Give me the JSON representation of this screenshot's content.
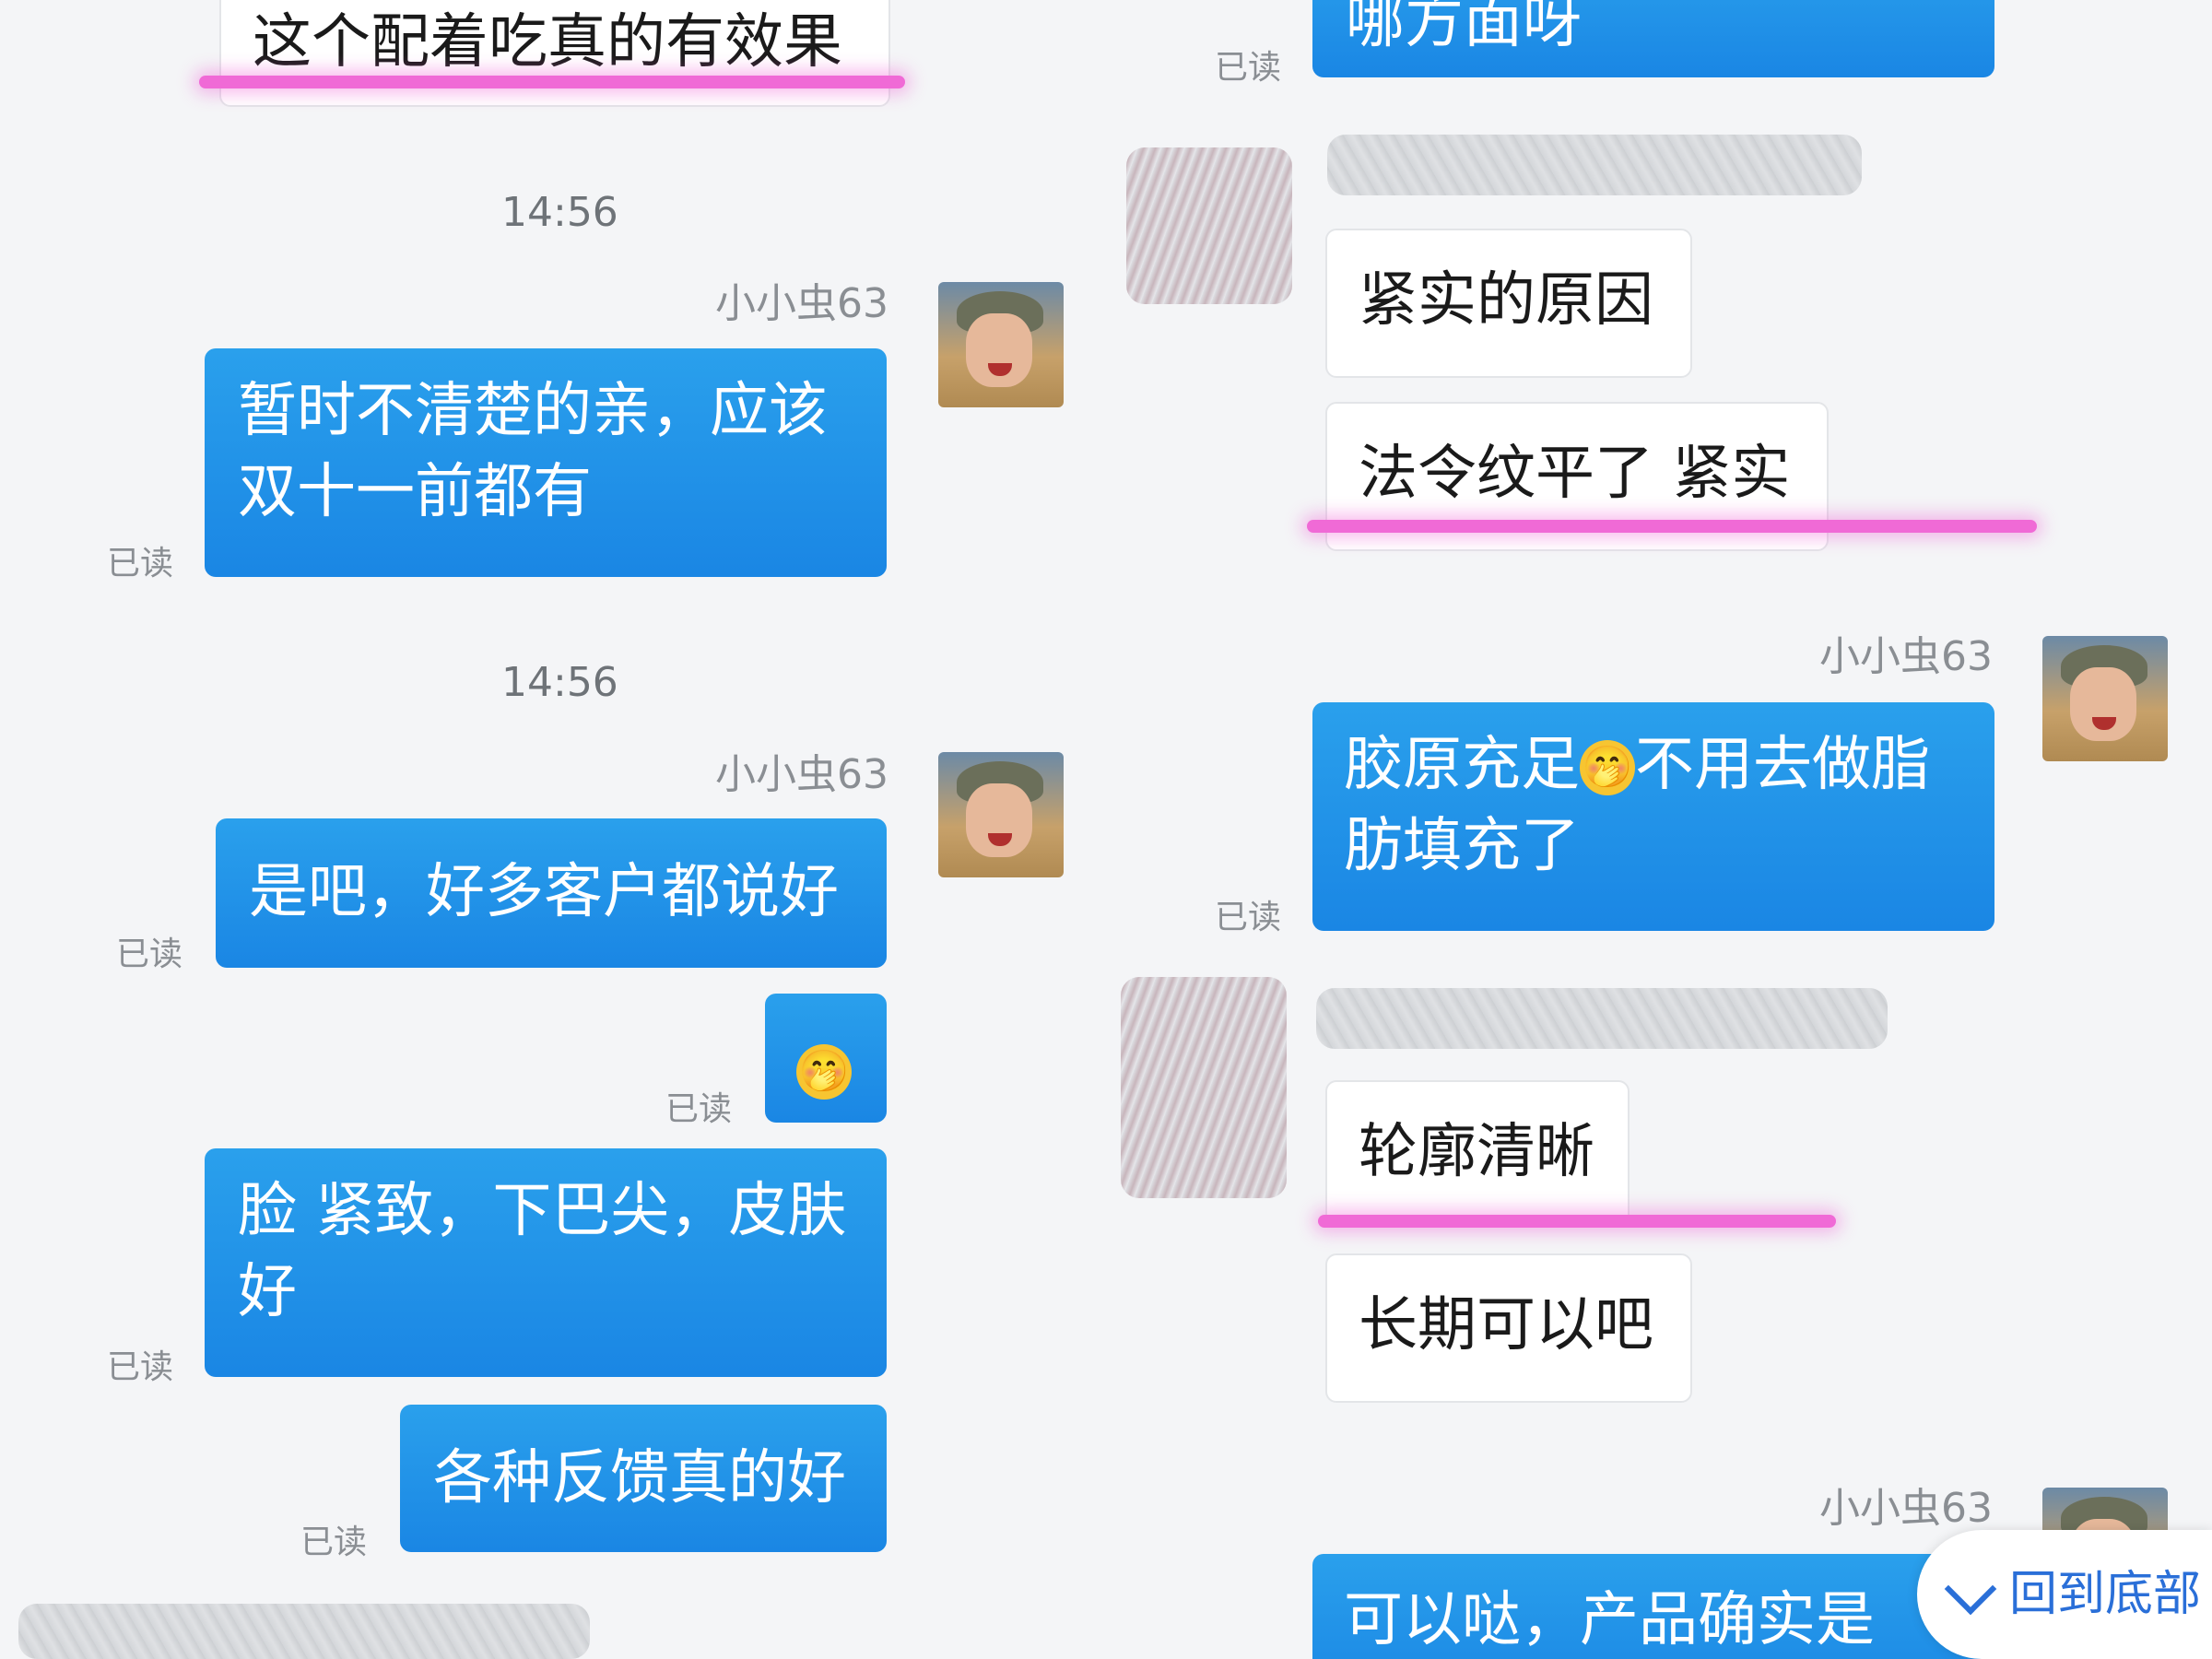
{
  "left": {
    "m1_text": "这个配着吃真的有效果",
    "time1": "14:56",
    "sender1": "小小虫63",
    "m2_line1": "暂时不清楚的亲，应该",
    "m2_line2": "双十一前都有",
    "read_m2": "已读",
    "time2": "14:56",
    "sender2": "小小虫63",
    "m3_text": "是吧，好多客户都说好",
    "read_m3": "已读",
    "m4_emoji": "🤭",
    "read_m4": "已读",
    "m5_line1": "脸 紧致，下巴尖，皮肤",
    "m5_line2": "好",
    "read_m5": "已读",
    "m6_text": "各种反馈真的好",
    "read_m6": "已读"
  },
  "right": {
    "r0_text": "哪方面呀",
    "read_r0": "已读",
    "r1_text": "紧实的原因",
    "r2_text": "法令纹平了 紧实",
    "sender3": "小小虫63",
    "r3_line1_a": "胶原充足",
    "r3_emoji": "🤭",
    "r3_line1_b": "不用去做脂",
    "r3_line2": "肪填充了",
    "read_r3": "已读",
    "r4_text": "轮廓清晰",
    "r5_text": "长期可以吧",
    "sender4": "小小虫63",
    "r6_text": "可以哒，产品确实是",
    "scroll_bottom": "回到底部"
  },
  "colors": {
    "bubble_blue": "#1a86e4",
    "highlight_pink": "#f06ad6",
    "background": "#f4f5f7"
  },
  "icons": [
    "avatar",
    "chevron-down-icon",
    "smirk-emoji"
  ]
}
